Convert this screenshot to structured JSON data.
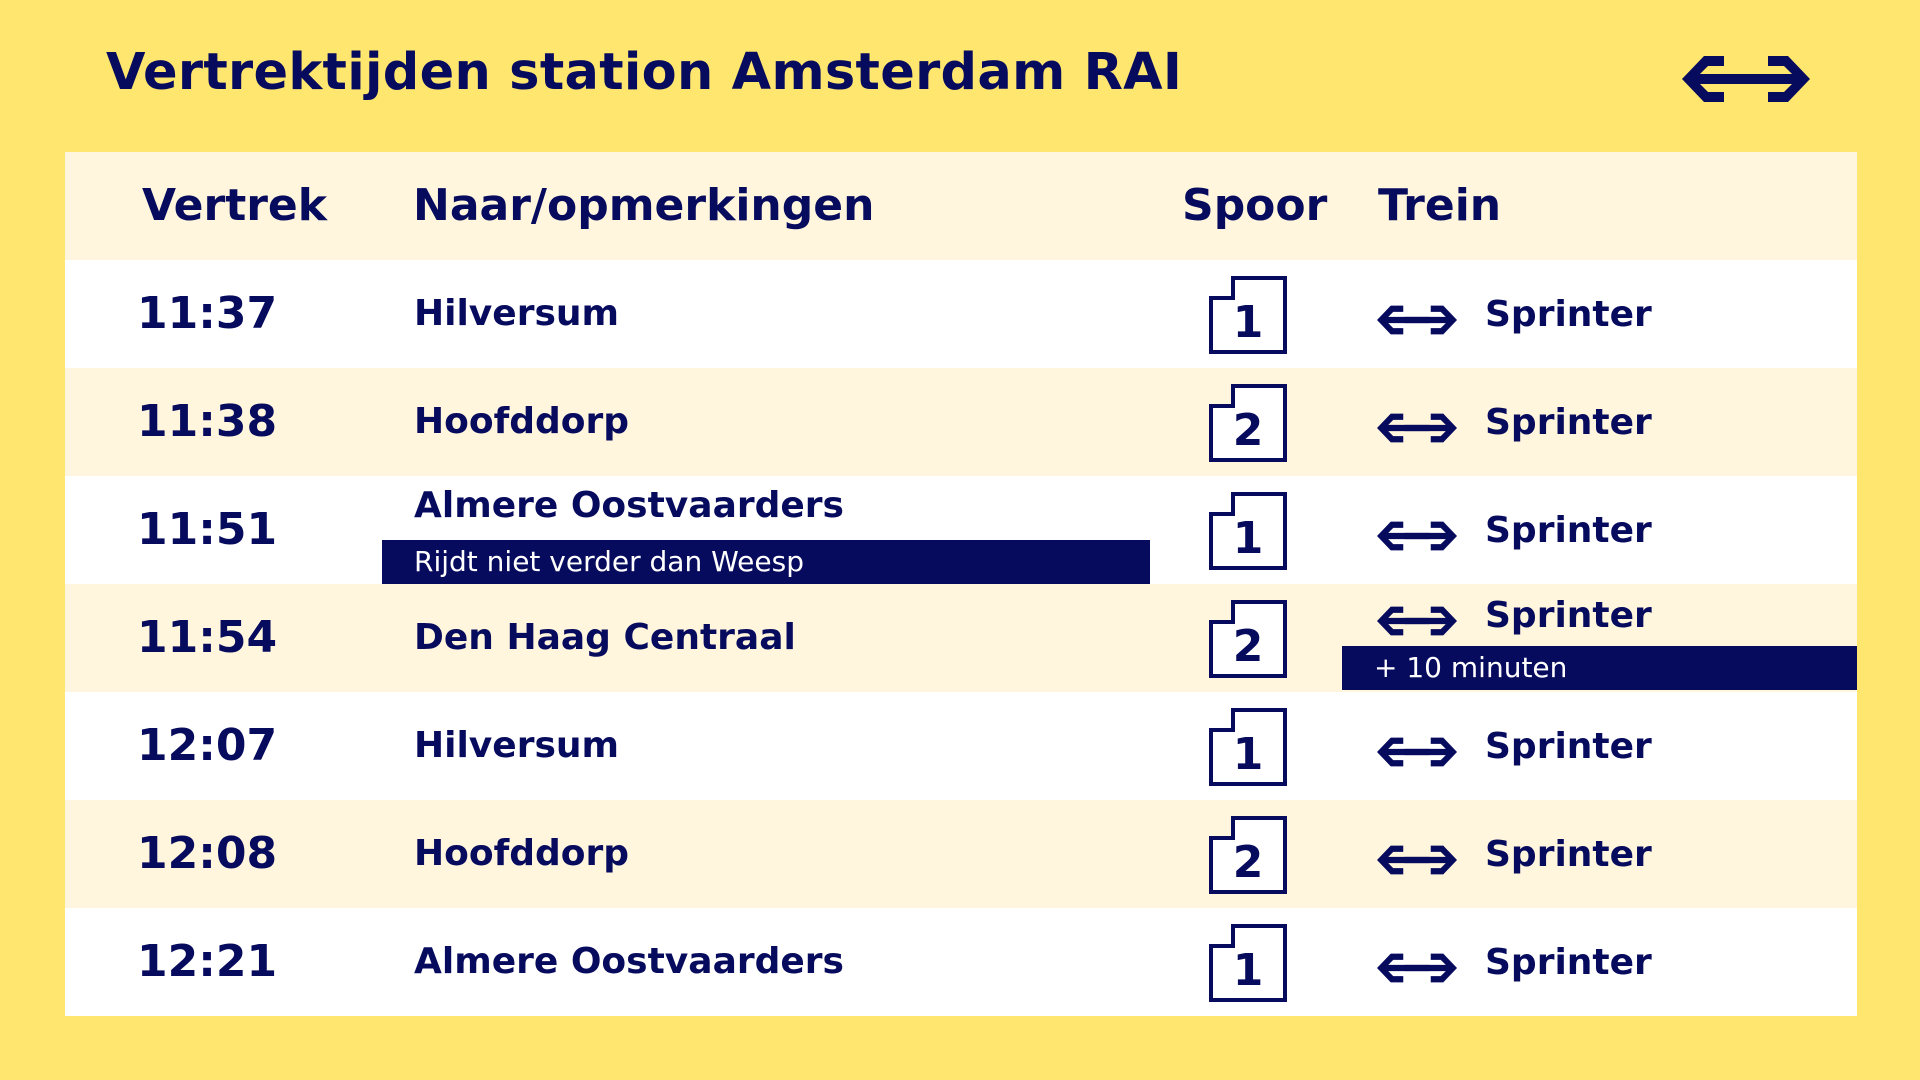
{
  "page": {
    "title": "Vertrektijden station Amsterdam RAI",
    "logo_icon": "ns-logo-icon"
  },
  "colors": {
    "background": "#ffe66e",
    "navy": "#070b5e",
    "row_light": "#ffffff",
    "row_cream": "#fff6dd"
  },
  "columns": {
    "departure": "Vertrek",
    "destination": "Naar/opmerkingen",
    "track": "Spoor",
    "train": "Trein"
  },
  "departures": [
    {
      "time": "11:37",
      "destination": "Hilversum",
      "note": "",
      "track": "1",
      "train": "Sprinter",
      "delay": ""
    },
    {
      "time": "11:38",
      "destination": "Hoofddorp",
      "note": "",
      "track": "2",
      "train": "Sprinter",
      "delay": ""
    },
    {
      "time": "11:51",
      "destination": "Almere Oostvaarders",
      "note": "Rijdt niet verder dan Weesp",
      "track": "1",
      "train": "Sprinter",
      "delay": ""
    },
    {
      "time": "11:54",
      "destination": "Den Haag Centraal",
      "note": "",
      "track": "2",
      "train": "Sprinter",
      "delay": "+ 10 minuten"
    },
    {
      "time": "12:07",
      "destination": "Hilversum",
      "note": "",
      "track": "1",
      "train": "Sprinter",
      "delay": ""
    },
    {
      "time": "12:08",
      "destination": "Hoofddorp",
      "note": "",
      "track": "2",
      "train": "Sprinter",
      "delay": ""
    },
    {
      "time": "12:21",
      "destination": "Almere Oostvaarders",
      "note": "",
      "track": "1",
      "train": "Sprinter",
      "delay": ""
    }
  ]
}
